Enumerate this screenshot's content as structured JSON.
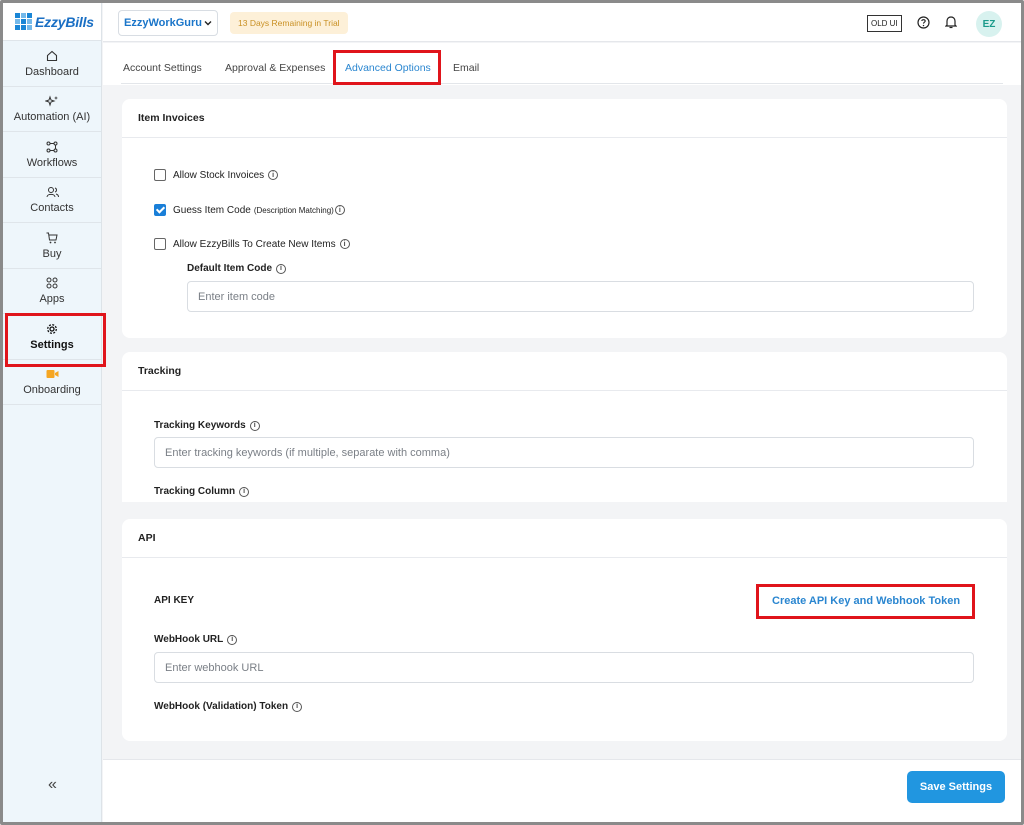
{
  "app": {
    "brand": "EzzyBills"
  },
  "sidebar": {
    "items": [
      {
        "label": "Dashboard",
        "icon": "home-icon"
      },
      {
        "label": "Automation (AI)",
        "icon": "sparkle-icon"
      },
      {
        "label": "Workflows",
        "icon": "workflow-icon"
      },
      {
        "label": "Contacts",
        "icon": "contacts-icon"
      },
      {
        "label": "Buy",
        "icon": "cart-icon"
      },
      {
        "label": "Apps",
        "icon": "apps-icon"
      },
      {
        "label": "Settings",
        "icon": "gear-icon"
      },
      {
        "label": "Onboarding",
        "icon": "video-icon"
      }
    ],
    "active": "Settings",
    "collapse_label": "«"
  },
  "topbar": {
    "org_name": "EzzyWorkGuru",
    "trial_badge": "13 Days Remaining in Trial",
    "old_ui_label": "OLD UI",
    "avatar_initials": "EZ"
  },
  "tabs": [
    {
      "label": "Account Settings"
    },
    {
      "label": "Approval & Expenses"
    },
    {
      "label": "Advanced Options"
    },
    {
      "label": "Email"
    }
  ],
  "active_tab": "Advanced Options",
  "item_invoices": {
    "title": "Item Invoices",
    "allow_stock": {
      "label": "Allow Stock Invoices",
      "checked": false
    },
    "guess_item": {
      "label": "Guess Item Code",
      "note": "(Description Matching)",
      "checked": true
    },
    "allow_create": {
      "label": "Allow EzzyBills To Create New Items",
      "checked": false
    },
    "default_code_label": "Default Item Code",
    "default_code_placeholder": "Enter item code"
  },
  "tracking": {
    "title": "Tracking",
    "keywords_label": "Tracking Keywords",
    "keywords_placeholder": "Enter tracking keywords (if multiple, separate with comma)",
    "column_label": "Tracking Column"
  },
  "api": {
    "title": "API",
    "key_label": "API KEY",
    "create_link": "Create API Key and Webhook Token",
    "webhook_url_label": "WebHook URL",
    "webhook_url_placeholder": "Enter webhook URL",
    "webhook_token_label": "WebHook (Validation) Token"
  },
  "footer": {
    "save_label": "Save Settings"
  },
  "colors": {
    "accent": "#2196e0",
    "highlight": "#e0141b",
    "trial_bg": "#fdf0d8"
  }
}
